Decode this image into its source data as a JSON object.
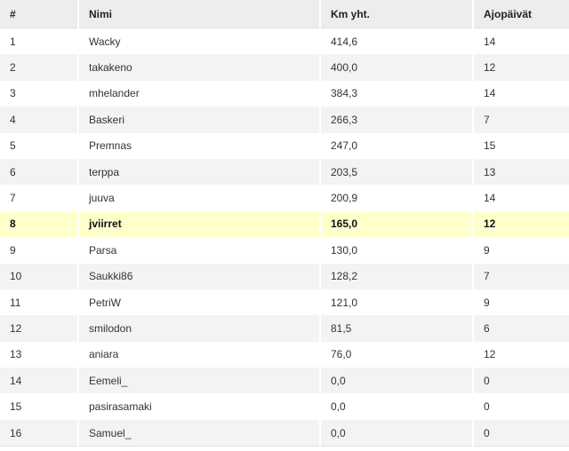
{
  "table": {
    "headers": {
      "rank": "#",
      "name": "Nimi",
      "km": "Km yht.",
      "days": "Ajopäivät"
    },
    "highlighted_row": 7,
    "colors": {
      "highlight_row": "#ffffcc",
      "header_bg": "#ededed",
      "alt_row_bg": "#f3f3f3"
    },
    "rows": [
      {
        "rank": "1",
        "name": "Wacky",
        "km": "414,6",
        "days": "14"
      },
      {
        "rank": "2",
        "name": "takakeno",
        "km": "400,0",
        "days": "12"
      },
      {
        "rank": "3",
        "name": "mhelander",
        "km": "384,3",
        "days": "14"
      },
      {
        "rank": "4",
        "name": "Baskeri",
        "km": "266,3",
        "days": "7"
      },
      {
        "rank": "5",
        "name": "Premnas",
        "km": "247,0",
        "days": "15"
      },
      {
        "rank": "6",
        "name": "terppa",
        "km": "203,5",
        "days": "13"
      },
      {
        "rank": "7",
        "name": "juuva",
        "km": "200,9",
        "days": "14"
      },
      {
        "rank": "8",
        "name": "jviirret",
        "km": "165,0",
        "days": "12"
      },
      {
        "rank": "9",
        "name": "Parsa",
        "km": "130,0",
        "days": "9"
      },
      {
        "rank": "10",
        "name": "Saukki86",
        "km": "128,2",
        "days": "7"
      },
      {
        "rank": "11",
        "name": "PetriW",
        "km": "121,0",
        "days": "9"
      },
      {
        "rank": "12",
        "name": "smilodon",
        "km": "81,5",
        "days": "6"
      },
      {
        "rank": "13",
        "name": "aniara",
        "km": "76,0",
        "days": "12"
      },
      {
        "rank": "14",
        "name": "Eemeli_",
        "km": "0,0",
        "days": "0"
      },
      {
        "rank": "15",
        "name": "pasirasamaki",
        "km": "0,0",
        "days": "0"
      },
      {
        "rank": "16",
        "name": "Samuel_",
        "km": "0,0",
        "days": "0"
      }
    ]
  }
}
